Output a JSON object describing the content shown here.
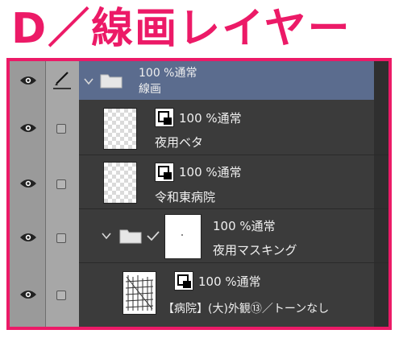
{
  "heading": "D／線画レイヤー",
  "layers": [
    {
      "id": "folder-lineart",
      "mode": "100 %通常",
      "name": "線画"
    },
    {
      "id": "yoru-beta",
      "mode": "100 %通常",
      "name": "夜用ベタ"
    },
    {
      "id": "reiwa",
      "mode": "100 %通常",
      "name": "令和東病院"
    },
    {
      "id": "yoru-mask",
      "mode": "100 %通常",
      "name": "夜用マスキング"
    },
    {
      "id": "byoin",
      "mode": "100 %通常",
      "name": "【病院】(大)外観⑬／トーンなし"
    }
  ],
  "colors": {
    "accent": "#ec1a67",
    "selected_row": "#5b6c8e",
    "panel": "#3b3b3b"
  }
}
